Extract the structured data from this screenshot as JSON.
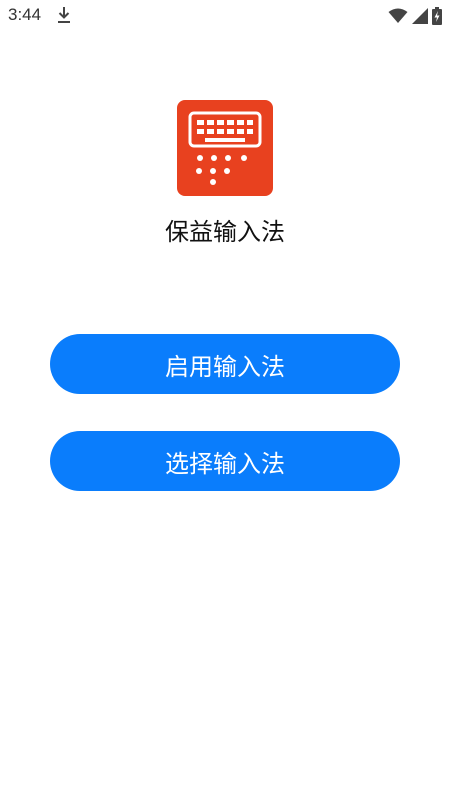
{
  "status_bar": {
    "time": "3:44",
    "icons": [
      "download-icon",
      "wifi-icon",
      "signal-icon",
      "battery-charging-icon"
    ]
  },
  "app": {
    "name": "保益输入法",
    "logo_icon": "keyboard-icon",
    "logo_color": "#e8411f"
  },
  "buttons": {
    "enable_label": "启用输入法",
    "select_label": "选择输入法",
    "color": "#0a7dfc"
  }
}
